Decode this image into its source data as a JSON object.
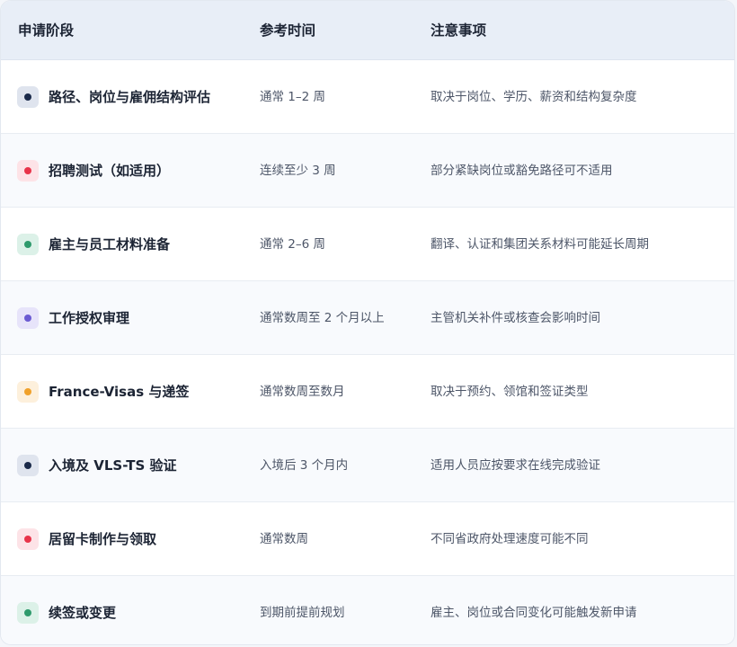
{
  "columns": {
    "stage": "申请阶段",
    "time": "参考时间",
    "notes": "注意事项"
  },
  "rows": [
    {
      "stage": "路径、岗位与雇佣结构评估",
      "time": "通常 1–2 周",
      "notes": "取决于岗位、学历、薪资和结构复杂度",
      "dot_color": "#1b2a4a",
      "box_color": "#dfe4ee"
    },
    {
      "stage": "招聘测试（如适用）",
      "time": "连续至少 3 周",
      "notes": "部分紧缺岗位或豁免路径可不适用",
      "dot_color": "#e8344a",
      "box_color": "#fde3e7"
    },
    {
      "stage": "雇主与员工材料准备",
      "time": "通常 2–6 周",
      "notes": "翻译、认证和集团关系材料可能延长周期",
      "dot_color": "#2e9a6c",
      "box_color": "#dcf1e8"
    },
    {
      "stage": "工作授权审理",
      "time": "通常数周至 2 个月以上",
      "notes": "主管机关补件或核查会影响时间",
      "dot_color": "#6b5bd2",
      "box_color": "#e7e4fa"
    },
    {
      "stage": "France-Visas 与递签",
      "time": "通常数周至数月",
      "notes": "取决于预约、领馆和签证类型",
      "dot_color": "#f0a12a",
      "box_color": "#fdf0dc"
    },
    {
      "stage": "入境及 VLS-TS 验证",
      "time": "入境后 3 个月内",
      "notes": "适用人员应按要求在线完成验证",
      "dot_color": "#1b2a4a",
      "box_color": "#dfe4ee"
    },
    {
      "stage": "居留卡制作与领取",
      "time": "通常数周",
      "notes": "不同省政府处理速度可能不同",
      "dot_color": "#e8344a",
      "box_color": "#fde3e7"
    },
    {
      "stage": "续签或变更",
      "time": "到期前提前规划",
      "notes": "雇主、岗位或合同变化可能触发新申请",
      "dot_color": "#2e9a6c",
      "box_color": "#dcf1e8"
    }
  ]
}
